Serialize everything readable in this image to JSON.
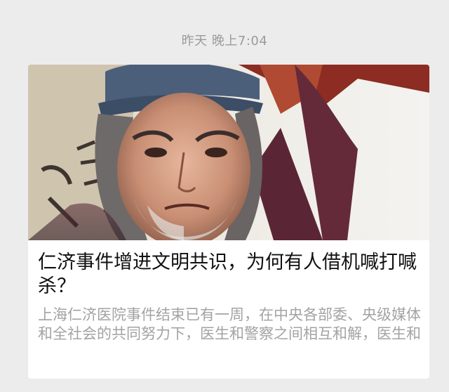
{
  "message": {
    "timestamp": "昨天 晚上7:04"
  },
  "article_card": {
    "title": "仁济事件增进文明共识，为何有人借机喊打喊杀？",
    "digest": "上海仁济医院事件结束已有一周，在中央各部委、央级媒体和全社会的共同努力下，医生和警察之间相互和解，医生和",
    "cover_image": "elderly-man-crying-still"
  },
  "colors": {
    "background": "#ececec",
    "card": "#ffffff",
    "title_text": "#111111",
    "digest_text": "#a3a3a3",
    "timestamp_text": "#9b9b9b"
  }
}
